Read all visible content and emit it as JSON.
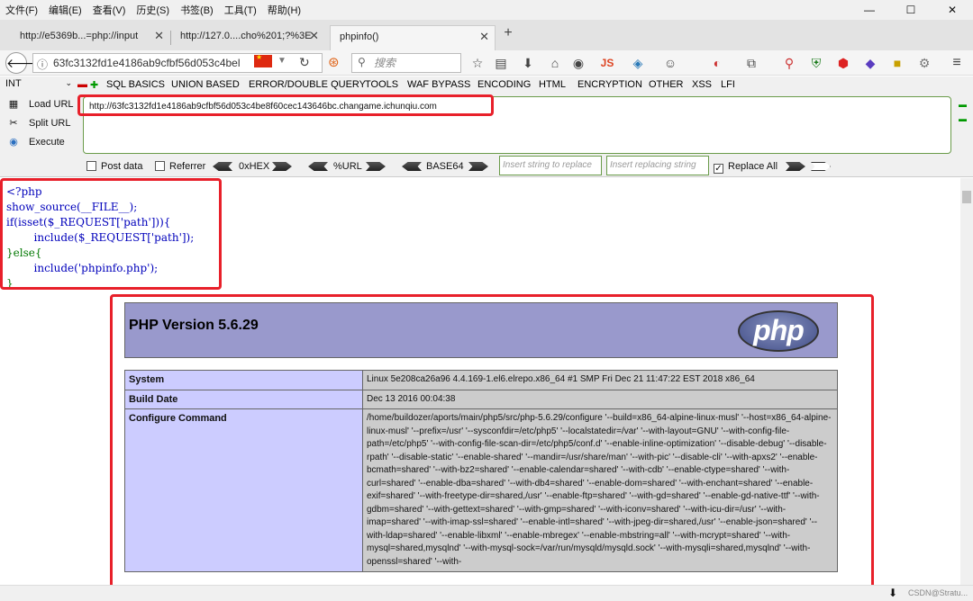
{
  "menubar": {
    "items": [
      "文件(F)",
      "编辑(E)",
      "查看(V)",
      "历史(S)",
      "书签(B)",
      "工具(T)",
      "帮助(H)"
    ],
    "window_controls": [
      "—",
      "☐",
      "✕"
    ]
  },
  "tabs": [
    {
      "label": "http://e5369b...=php://input"
    },
    {
      "label": "http://127.0....cho%201;?%3E"
    },
    {
      "label": "phpinfo()"
    }
  ],
  "navbar": {
    "url": "63fc3132fd1e4186ab9cfbf56d053c4bel",
    "search_placeholder": "搜索",
    "js_label": "JS"
  },
  "hackbar": {
    "int_select": "INT",
    "menu": [
      "SQL BASICS",
      "UNION BASED",
      "ERROR/DOUBLE QUERY",
      "TOOLS",
      "WAF BYPASS",
      "ENCODING",
      "HTML",
      "ENCRYPTION",
      "OTHER",
      "XSS",
      "LFI"
    ],
    "load_url": "Load URL",
    "split_url": "Split URL",
    "execute": "Execute",
    "url_value": "http://63fc3132fd1e4186ab9cfbf56d053c4be8f60cec143646bc.changame.ichunqiu.com",
    "post_data": "Post data",
    "referrer": "Referrer",
    "hex": "0xHEX",
    "purl": "%URL",
    "base64": "BASE64",
    "insert_placeholder": "Insert string to replace",
    "replacing_placeholder": "Insert replacing string",
    "replace_all": "Replace All"
  },
  "source_code": {
    "lines": [
      "<?php",
      "show_source(__FILE__);",
      "if(isset($_REQUEST['path'])){",
      "        include($_REQUEST['path']);",
      "}else{",
      "        include('phpinfo.php');",
      "}"
    ]
  },
  "phpinfo": {
    "version": "PHP Version 5.6.29",
    "logo_text": "php",
    "rows": [
      {
        "key": "System",
        "value": "Linux 5e208ca26a96 4.4.169-1.el6.elrepo.x86_64 #1 SMP Fri Dec 21 11:47:22 EST 2018 x86_64"
      },
      {
        "key": "Build Date",
        "value": "Dec 13 2016 00:04:38"
      },
      {
        "key": "Configure Command",
        "value": "/home/buildozer/aports/main/php5/src/php-5.6.29/configure '--build=x86_64-alpine-linux-musl' '--host=x86_64-alpine-linux-musl' '--prefix=/usr' '--sysconfdir=/etc/php5' '--localstatedir=/var' '--with-layout=GNU' '--with-config-file-path=/etc/php5' '--with-config-file-scan-dir=/etc/php5/conf.d' '--enable-inline-optimization' '--disable-debug' '--disable-rpath' '--disable-static' '--enable-shared' '--mandir=/usr/share/man' '--with-pic' '--disable-cli' '--with-apxs2' '--enable-bcmath=shared' '--with-bz2=shared' '--enable-calendar=shared' '--with-cdb' '--enable-ctype=shared' '--with-curl=shared' '--enable-dba=shared' '--with-db4=shared' '--enable-dom=shared' '--with-enchant=shared' '--enable-exif=shared' '--with-freetype-dir=shared,/usr' '--enable-ftp=shared' '--with-gd=shared' '--enable-gd-native-ttf' '--with-gdbm=shared' '--with-gettext=shared' '--with-gmp=shared' '--with-iconv=shared' '--with-icu-dir=/usr' '--with-imap=shared' '--with-imap-ssl=shared' '--enable-intl=shared' '--with-jpeg-dir=shared,/usr' '--enable-json=shared' '--with-ldap=shared' '--enable-libxml' '--enable-mbregex' '--enable-mbstring=all' '--with-mcrypt=shared' '--with-mysql=shared,mysqlnd' '--with-mysql-sock=/var/run/mysqld/mysqld.sock' '--with-mysqli=shared,mysqlnd' '--with-openssl=shared' '--with-"
      }
    ]
  },
  "statusbar": {
    "watermark": "CSDN@Stratu..."
  }
}
